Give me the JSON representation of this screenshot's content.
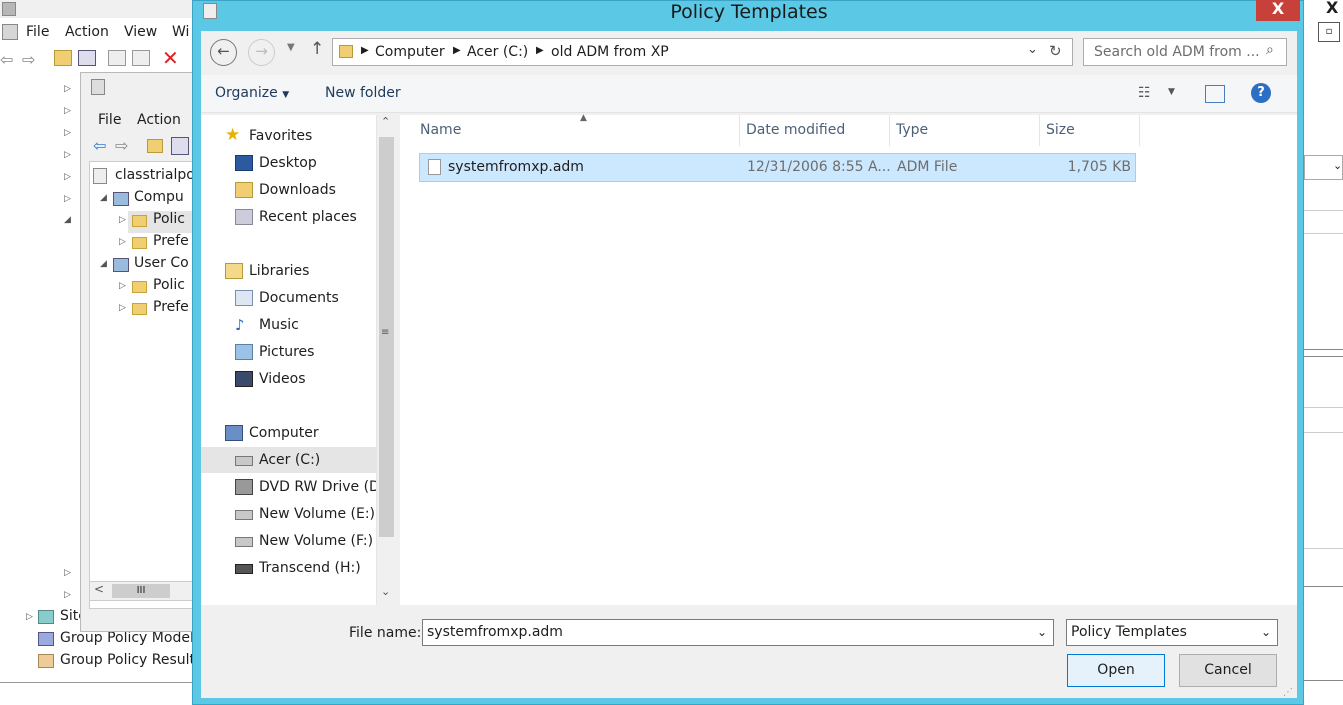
{
  "bg_app": {
    "menu": [
      "File",
      "Action",
      "View",
      "Wi"
    ],
    "tree_bottom": [
      "Site",
      "Group Policy Model",
      "Group Policy Results"
    ]
  },
  "mmc": {
    "menu": [
      "File",
      "Action"
    ],
    "tree": [
      "classtrialpol",
      "Compu",
      "Polic",
      "Prefe",
      "User Co",
      "Polic",
      "Prefe"
    ],
    "scroll_grip": "III"
  },
  "dialog": {
    "title": "Policy Templates",
    "close": "X",
    "breadcrumb": [
      "Computer",
      "Acer (C:)",
      "old ADM from XP"
    ],
    "search_placeholder": "Search old ADM from ...",
    "organize": "Organize",
    "new_folder": "New folder",
    "nav": {
      "favorites_header": "Favorites",
      "favorites": [
        "Desktop",
        "Downloads",
        "Recent places"
      ],
      "libraries_header": "Libraries",
      "libraries": [
        "Documents",
        "Music",
        "Pictures",
        "Videos"
      ],
      "computer_header": "Computer",
      "drives": [
        "Acer (C:)",
        "DVD RW Drive (D",
        "New Volume (E:)",
        "New Volume (F:)",
        "Transcend (H:)"
      ]
    },
    "columns": [
      "Name",
      "Date modified",
      "Type",
      "Size"
    ],
    "files": [
      {
        "name": "systemfromxp.adm",
        "date": "12/31/2006 8:55 A...",
        "type": "ADM File",
        "size": "1,705 KB"
      }
    ],
    "file_name_label": "File name:",
    "file_name_value": "systemfromxp.adm",
    "filter": "Policy Templates",
    "open": "Open",
    "cancel": "Cancel"
  },
  "colors": {
    "accent": "#5bc8e6",
    "selection": "#cce8ff",
    "close": "#c7413a"
  }
}
